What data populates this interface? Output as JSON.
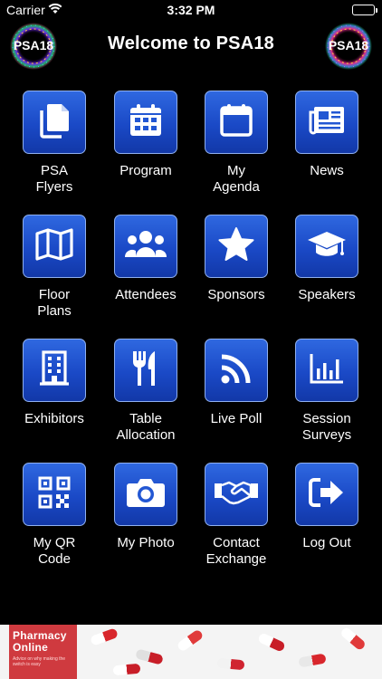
{
  "status_bar": {
    "carrier": "Carrier",
    "time": "3:32 PM"
  },
  "header": {
    "title": "Welcome to PSA18",
    "logo_text": "PSA18"
  },
  "tiles": [
    {
      "label": "PSA\nFlyers",
      "icon": "copy-icon"
    },
    {
      "label": "Program",
      "icon": "calendar-grid-icon"
    },
    {
      "label": "My\nAgenda",
      "icon": "calendar-icon"
    },
    {
      "label": "News",
      "icon": "newspaper-icon"
    },
    {
      "label": "Floor\nPlans",
      "icon": "map-icon"
    },
    {
      "label": "Attendees",
      "icon": "users-icon"
    },
    {
      "label": "Sponsors",
      "icon": "star-icon"
    },
    {
      "label": "Speakers",
      "icon": "graduation-cap-icon"
    },
    {
      "label": "Exhibitors",
      "icon": "building-icon"
    },
    {
      "label": "Table\nAllocation",
      "icon": "cutlery-icon"
    },
    {
      "label": "Live Poll",
      "icon": "rss-icon"
    },
    {
      "label": "Session\nSurveys",
      "icon": "bar-chart-icon"
    },
    {
      "label": "My QR\nCode",
      "icon": "qr-code-icon"
    },
    {
      "label": "My Photo",
      "icon": "camera-icon"
    },
    {
      "label": "Contact\nExchange",
      "icon": "handshake-icon"
    },
    {
      "label": "Log Out",
      "icon": "sign-out-icon"
    }
  ],
  "ad": {
    "title": "Pharmacy Online",
    "subtitle": "Advice on why making the switch is easy"
  },
  "colors": {
    "tile_top": "#2f68e0",
    "tile_bottom": "#1238a8",
    "tile_border": "#8fb0f0",
    "background": "#000000",
    "ad_red": "#cf3a3f"
  }
}
